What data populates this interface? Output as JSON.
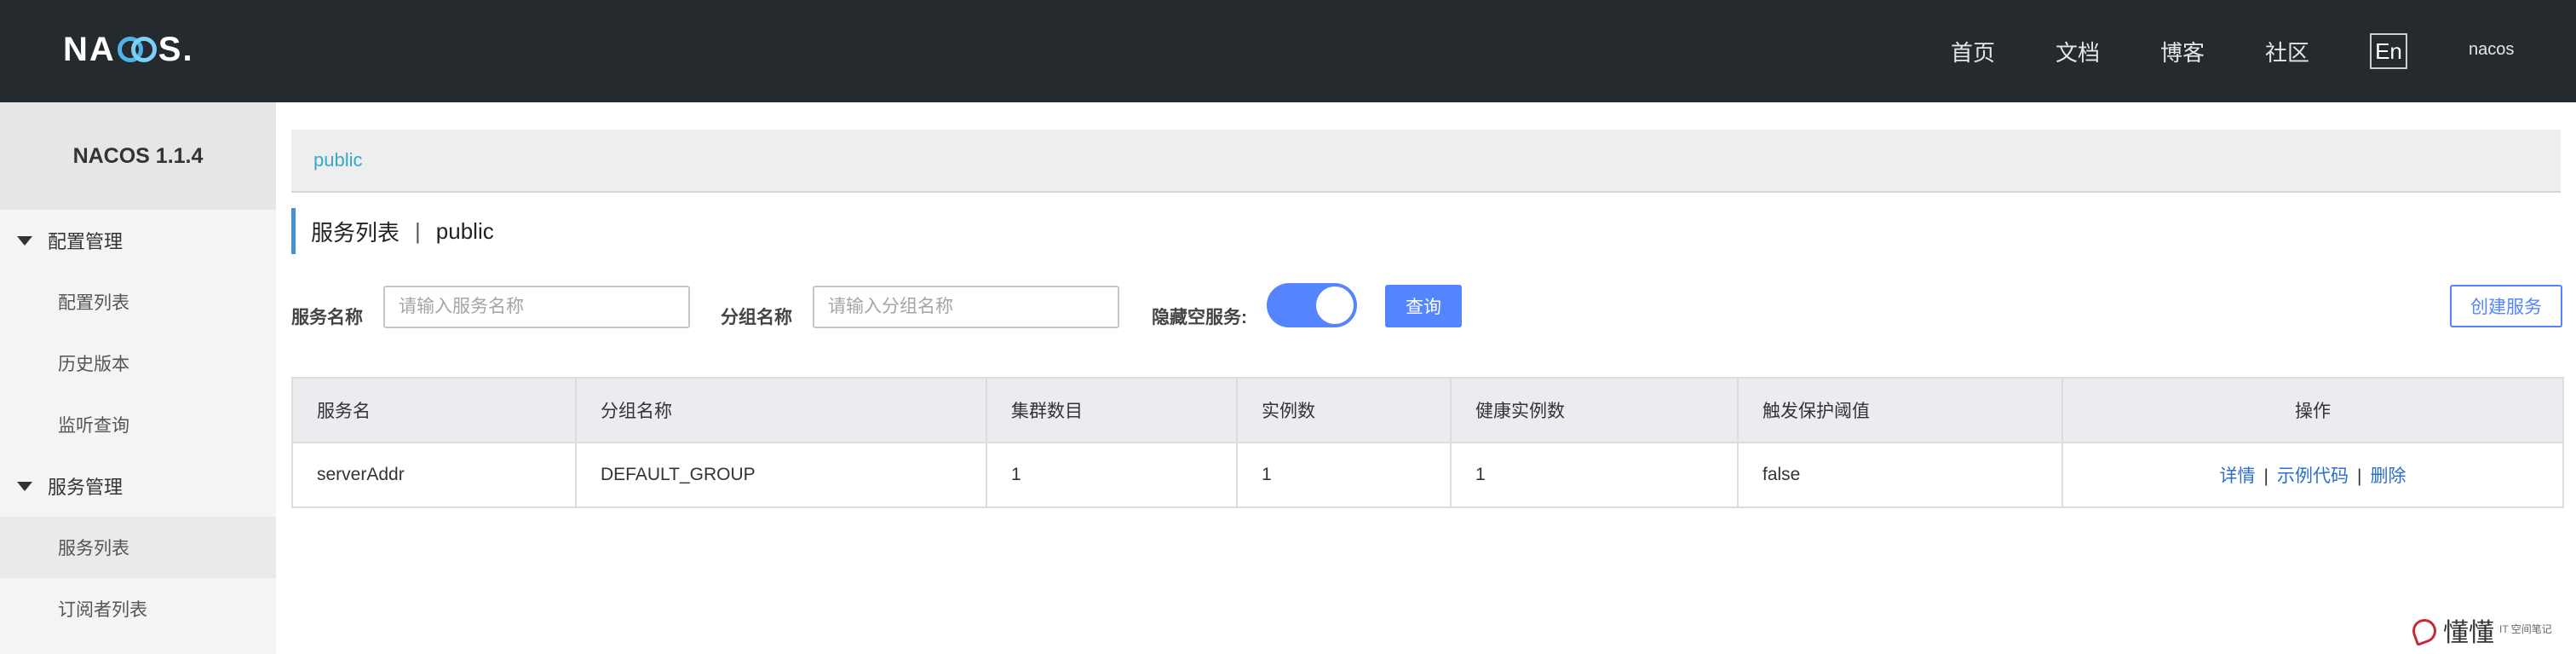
{
  "header": {
    "logo": {
      "part1": "NA",
      "part2": "S.",
      "ring_icon": "nacos-infinity-icon"
    },
    "nav": [
      "首页",
      "文档",
      "博客",
      "社区"
    ],
    "lang_button": "En",
    "user": "nacos"
  },
  "sidebar": {
    "version": "NACOS 1.1.4",
    "groups": [
      {
        "label": "配置管理",
        "items": [
          "配置列表",
          "历史版本",
          "监听查询"
        ]
      },
      {
        "label": "服务管理",
        "items": [
          "服务列表",
          "订阅者列表"
        ]
      }
    ],
    "active_item": "服务列表"
  },
  "main": {
    "namespace": "public",
    "title": {
      "name": "服务列表",
      "separator": "|",
      "namespace": "public"
    },
    "filters": {
      "service_label": "服务名称",
      "service_placeholder": "请输入服务名称",
      "group_label": "分组名称",
      "group_placeholder": "请输入分组名称",
      "hide_empty_label": "隐藏空服务:",
      "hide_empty_on": true,
      "query_button": "查询",
      "create_button": "创建服务"
    },
    "table": {
      "columns": [
        "服务名",
        "分组名称",
        "集群数目",
        "实例数",
        "健康实例数",
        "触发保护阈值",
        "操作"
      ],
      "rows": [
        {
          "service": "serverAddr",
          "group": "DEFAULT_GROUP",
          "clusters": "1",
          "instances": "1",
          "healthy": "1",
          "threshold": "false",
          "actions": [
            "详情",
            "示例代码",
            "删除"
          ]
        }
      ]
    }
  },
  "watermark": {
    "text": "懂懂",
    "sub": "IT 空间笔记"
  },
  "colors": {
    "topbar": "#252a2f",
    "primary": "#5584ff",
    "link": "#2b6fc8",
    "namespace": "#33aacc",
    "title_accent": "#4891d1"
  }
}
